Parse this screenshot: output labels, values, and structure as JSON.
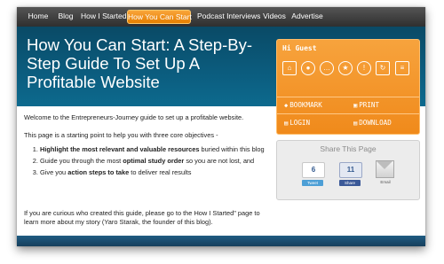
{
  "nav": {
    "items": [
      "Home",
      "Blog",
      "How I Started",
      "How You Can Start",
      "Podcast Interviews",
      "Videos",
      "Advertise"
    ],
    "active_index": 3
  },
  "hero": {
    "title": "How You Can Start: A Step-By-Step Guide To Set Up A Profitable Website"
  },
  "content": {
    "welcome": "Welcome to the Entrepreneurs-Journey guide to set up a profitable website.",
    "intro": "This page is a starting point to help you with three core objectives -",
    "objectives": [
      {
        "pre": "",
        "strong": "Highlight the most relevant and valuable resources",
        "post": " buried within this blog"
      },
      {
        "pre": "Guide you through the most ",
        "strong": "optimal study order",
        "post": " so you are not lost, and"
      },
      {
        "pre": "Give you ",
        "strong": "action steps to take",
        "post": " to deliver real results"
      }
    ],
    "outro": "If you are curious who created this guide, please go to the How I Started\" page to learn more about my story (Yaro Starak, the founder of this blog)."
  },
  "member_box": {
    "greeting": "Hi Guest",
    "icons": [
      "home-icon",
      "user-icon",
      "chat-icon",
      "star-icon",
      "bulb-icon",
      "refresh-icon",
      "document-icon"
    ],
    "bookmark": "BOOKMARK",
    "print": "PRINT",
    "login": "LOGIN",
    "download": "DOWNLOAD"
  },
  "share": {
    "title": "Share This Page",
    "tweet_count": "6",
    "tweet_label": "Tweet",
    "share_count": "11",
    "share_label": "Share",
    "email_label": "Email"
  },
  "colors": {
    "nav_bg": "#3a3a3a",
    "accent_orange": "#f39323",
    "hero_blue": "#0b5d7f",
    "twitter_blue": "#4d9fd6",
    "facebook_blue": "#3b5998"
  }
}
